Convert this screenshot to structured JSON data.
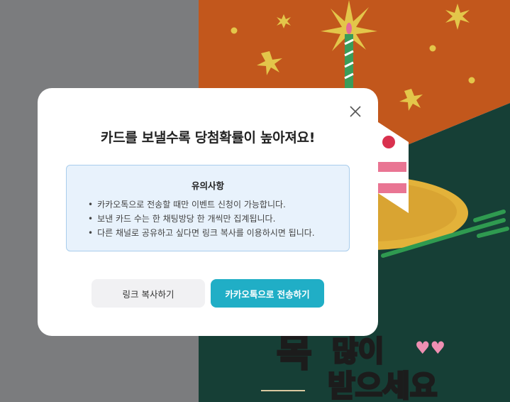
{
  "modal": {
    "title": "카드를 보낼수록 당첨확률이 높아져요!",
    "notice": {
      "title": "유의사항",
      "items": [
        "카카오톡으로 전송할 때만 이벤트 신청이 가능합니다.",
        "보낸 카드 수는 한 채팅방당 한 개씩만 집계됩니다.",
        "다른 채널로 공유하고 싶다면 링크 복사를 이용하시면 됩니다."
      ]
    },
    "buttons": {
      "copy_link": "링크 복사하기",
      "send_kakao": "카카오톡으로 전송하기"
    },
    "close_icon": "close-icon"
  },
  "background": {
    "text_line1": "많이",
    "text_line2": "받으세요"
  },
  "colors": {
    "overlay_gray": "#7b7c7e",
    "illustration_orange": "#c2571c",
    "illustration_green": "#163f36",
    "accent_button": "#20aec6",
    "notice_bg": "#e8f2fc",
    "notice_border": "#a9cdec"
  }
}
